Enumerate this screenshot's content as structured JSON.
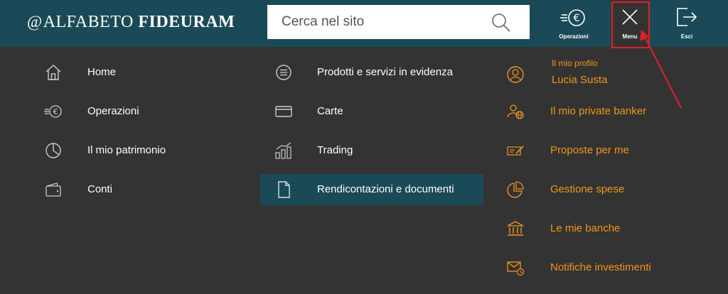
{
  "header": {
    "logo_prefix": "@",
    "logo_light": "ALFABETO",
    "logo_strong": "FIDEURAM",
    "search_placeholder": "Cerca nel sito",
    "buttons": {
      "operazioni": "Operazioni",
      "menu": "Menu",
      "esci": "Esci"
    }
  },
  "menu": {
    "column1": [
      {
        "label": "Home",
        "icon": "home-icon"
      },
      {
        "label": "Operazioni",
        "icon": "euro-transfer-icon"
      },
      {
        "label": "Il mio patrimonio",
        "icon": "pie-chart-icon"
      },
      {
        "label": "Conti",
        "icon": "wallet-icon"
      }
    ],
    "column2": [
      {
        "label": "Prodotti e servizi in evidenza",
        "icon": "list-circle-icon"
      },
      {
        "label": "Carte",
        "icon": "card-icon"
      },
      {
        "label": "Trading",
        "icon": "trading-chart-icon"
      },
      {
        "label": "Rendicontazioni e documenti",
        "icon": "document-icon",
        "active": true
      }
    ],
    "column3": {
      "profile_label": "Il mio profilo",
      "profile_name": "Lucia Susta",
      "items": [
        {
          "label": "Il mio private banker",
          "icon": "banker-globe-icon"
        },
        {
          "label": "Proposte per me",
          "icon": "proposal-icon"
        },
        {
          "label": "Gestione spese",
          "icon": "expense-pie-icon"
        },
        {
          "label": "Le mie banche",
          "icon": "bank-icon"
        },
        {
          "label": "Notifiche investimenti",
          "icon": "notification-mail-icon"
        }
      ]
    }
  },
  "colors": {
    "header_bg": "#1a4a57",
    "menu_bg": "#333333",
    "accent_orange": "#f0961e",
    "annotation_red": "#e0202a"
  }
}
